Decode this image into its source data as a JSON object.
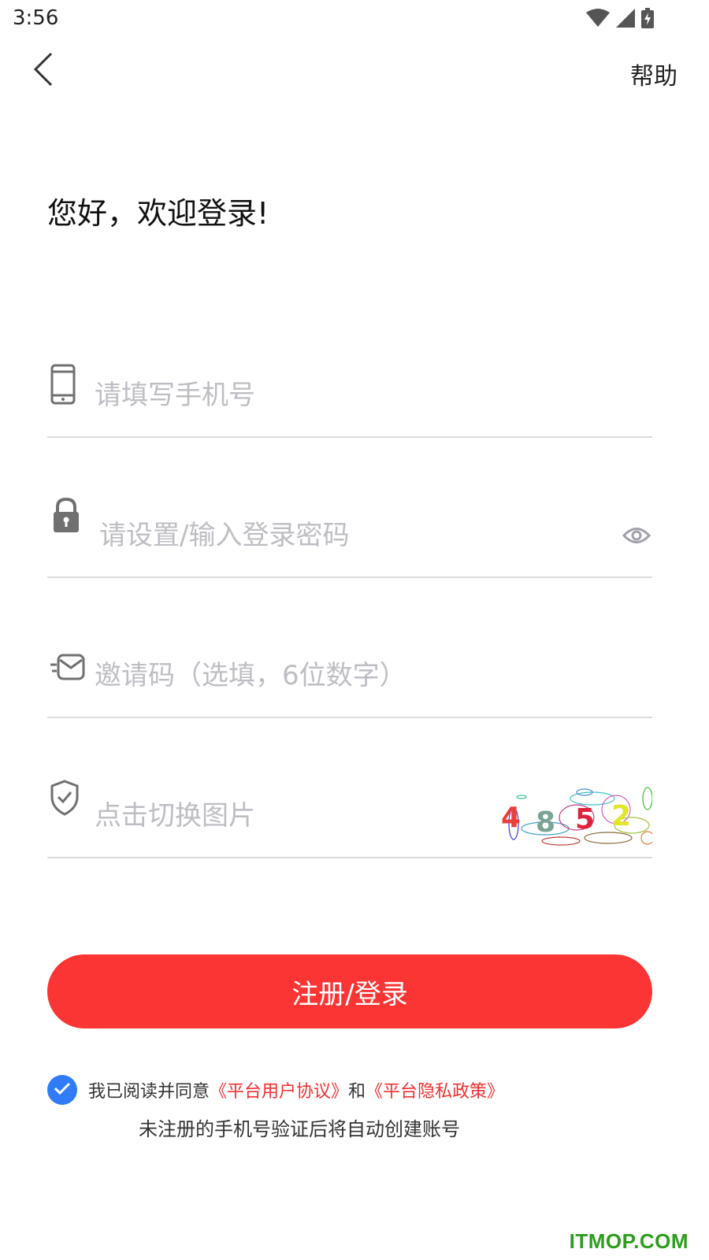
{
  "status_bar": {
    "time": "3:56",
    "icons": [
      "wifi-icon",
      "cell-signal-icon",
      "battery-charging-icon"
    ]
  },
  "nav": {
    "back_icon": "chevron-left-icon",
    "help_label": "帮助"
  },
  "welcome": {
    "title": "您好，欢迎登录!"
  },
  "form": {
    "phone": {
      "icon": "phone-icon",
      "placeholder": "请填写手机号",
      "value": ""
    },
    "password": {
      "icon": "lock-icon",
      "placeholder": "请设置/输入登录密码",
      "value": "",
      "toggle_icon": "eye-icon"
    },
    "invite": {
      "icon": "mail-icon",
      "placeholder": "邀请码（选填，6位数字）",
      "value": ""
    },
    "captcha": {
      "icon": "shield-check-icon",
      "placeholder": "点击切换图片",
      "value": "",
      "image_text": [
        "4",
        "8",
        "5",
        "2"
      ],
      "image_colors": [
        "#e8413a",
        "#7aa394",
        "#e0233c",
        "#e2e62a"
      ]
    }
  },
  "submit": {
    "label": "注册/登录",
    "color": "#fb3434"
  },
  "agreement": {
    "checked": true,
    "prefix": "我已阅读并同意",
    "user_agreement": "《平台用户协议》",
    "conjunction": "和",
    "privacy_policy": "《平台隐私政策》",
    "note": "未注册的手机号验证后将自动创建账号"
  },
  "watermark": {
    "text": "ITMOP.COM"
  }
}
